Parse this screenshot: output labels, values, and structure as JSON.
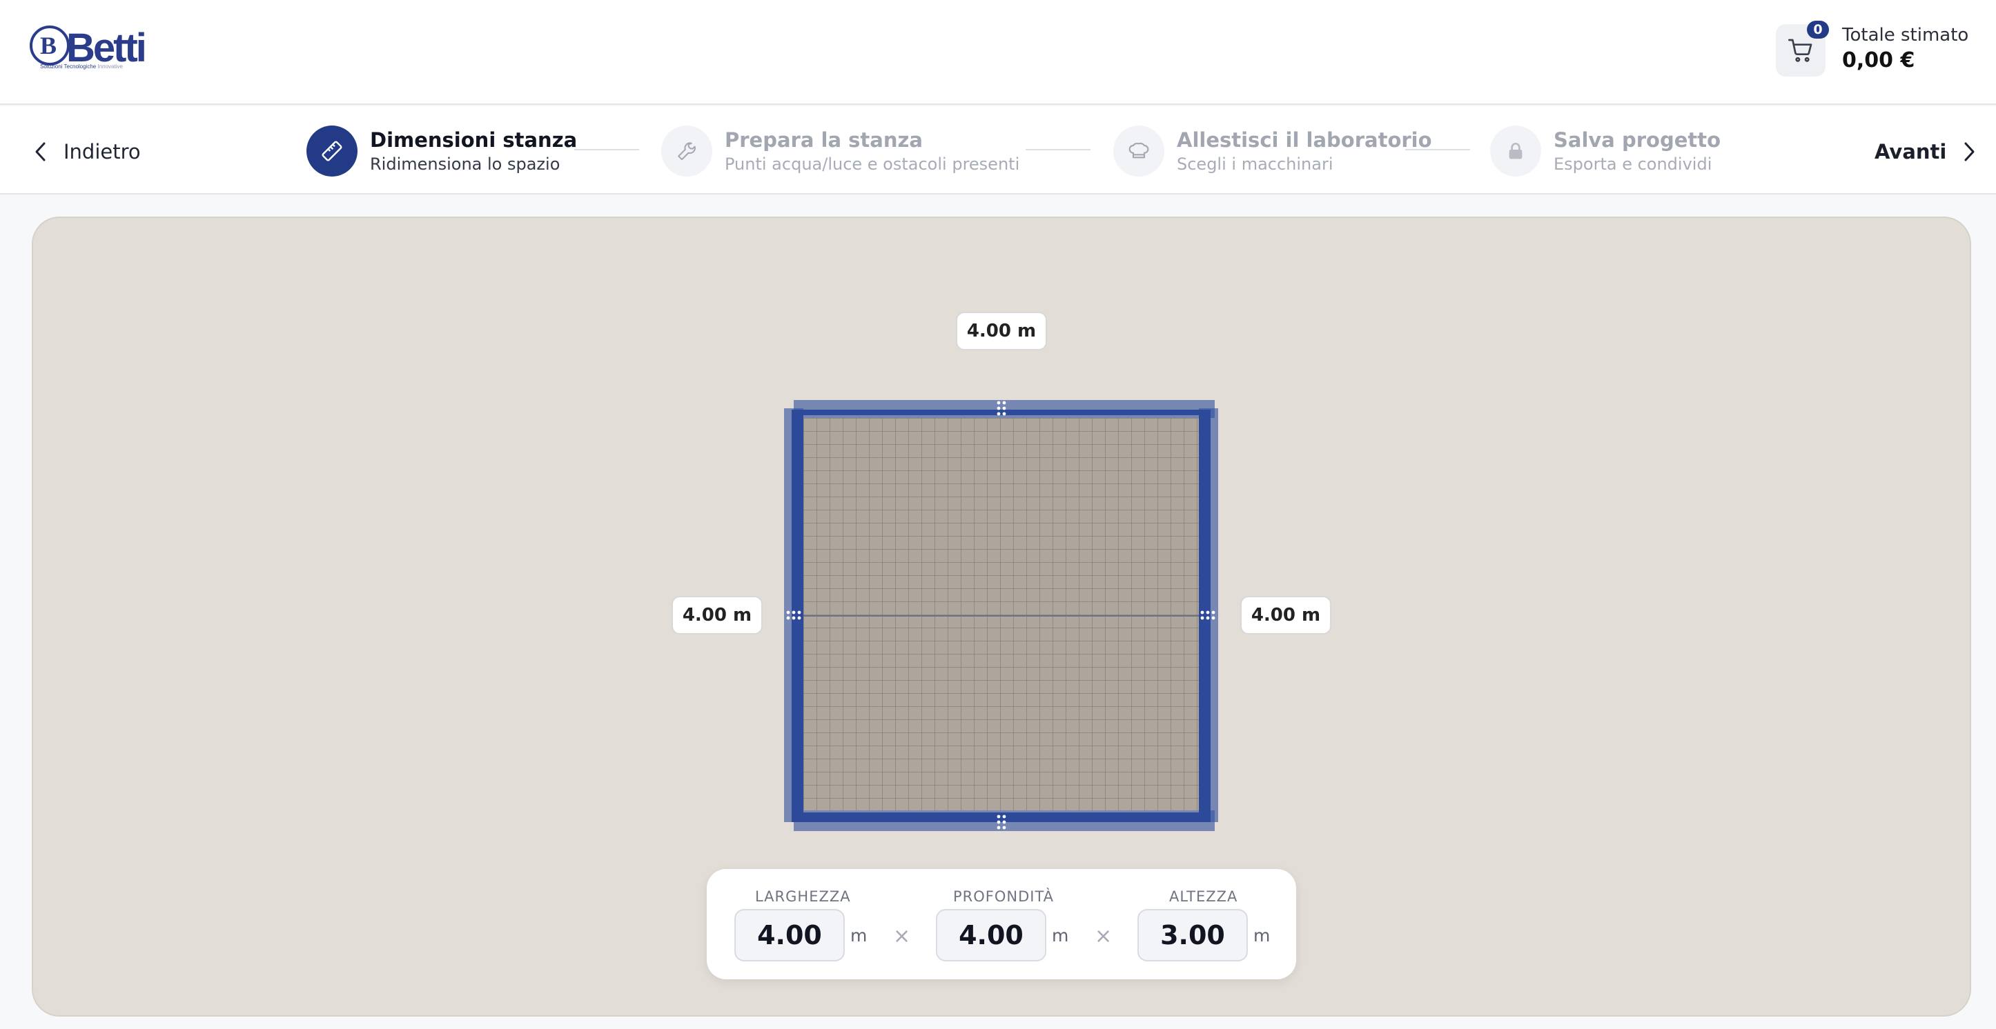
{
  "header": {
    "logo": {
      "word": "Betti",
      "tagline_main": "Soluzioni Tecnologiche",
      "tagline_accent": "Innovative"
    },
    "cart_badge": "0",
    "total_label": "Totale stimato",
    "total_value": "0,00 €"
  },
  "stepper": {
    "back_label": "Indietro",
    "next_label": "Avanti",
    "steps": [
      {
        "title": "Dimensioni stanza",
        "subtitle": "Ridimensiona lo spazio",
        "icon": "ruler-icon",
        "state": "active"
      },
      {
        "title": "Prepara la stanza",
        "subtitle": "Punti acqua/luce e ostacoli presenti",
        "icon": "wrench-icon",
        "state": "inactive"
      },
      {
        "title": "Allestisci il laboratorio",
        "subtitle": "Scegli i macchinari",
        "icon": "chef-hat-icon",
        "state": "inactive"
      },
      {
        "title": "Salva progetto",
        "subtitle": "Esporta e condividi",
        "icon": "lock-icon",
        "state": "locked"
      }
    ]
  },
  "room": {
    "top_label": "4.00 m",
    "left_label": "4.00 m",
    "right_label": "4.00 m"
  },
  "dimensions": {
    "width": {
      "label": "LARGHEZZA",
      "value": "4.00",
      "unit": "m"
    },
    "depth": {
      "label": "PROFONDITÀ",
      "value": "4.00",
      "unit": "m"
    },
    "height": {
      "label": "ALTEZZA",
      "value": "3.00",
      "unit": "m"
    },
    "separator": "×"
  },
  "colors": {
    "brand": "#233b87",
    "wall": "#3452a0",
    "canvas_bg": "#e2ddd6",
    "floor": "#aea69c"
  }
}
